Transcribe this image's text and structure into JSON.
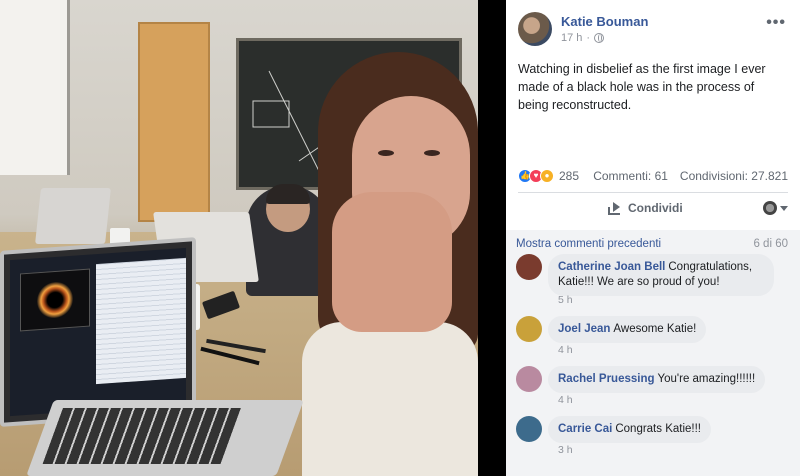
{
  "post": {
    "author": "Katie Bouman",
    "time": "17 h",
    "more": "•••",
    "text": "Watching in disbelief as the first image I ever made of a black hole was in the process of being reconstructed."
  },
  "stats": {
    "reaction_count": "285",
    "comments": "Commenti: 61",
    "shares": "Condivisioni: 27.821"
  },
  "actions": {
    "share_label": "Condividi"
  },
  "comments_section": {
    "show_previous": "Mostra commenti precedenti",
    "count": "6 di 60",
    "items": [
      {
        "name": "Catherine Joan Bell",
        "text": "Congratulations, Katie!!! We are so proud of you!",
        "time": "5 h",
        "avatar_color": "#7a3b2e"
      },
      {
        "name": "Joel Jean",
        "text": "Awesome Katie!",
        "time": "4 h",
        "avatar_color": "#c9a13a"
      },
      {
        "name": "Rachel Pruessing",
        "text": "You're amazing!!!!!!",
        "time": "4 h",
        "avatar_color": "#b98aa0"
      },
      {
        "name": "Carrie Cai",
        "text": "Congrats Katie!!!",
        "time": "3 h",
        "avatar_color": "#3d6b8c"
      }
    ]
  },
  "colors": {
    "link": "#385898",
    "like": "#2078f4",
    "love": "#f33e58",
    "wow": "#f7b125"
  }
}
